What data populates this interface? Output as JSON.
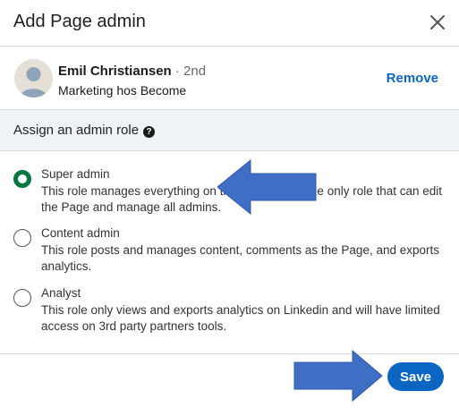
{
  "dialog": {
    "title": "Add Page admin"
  },
  "user": {
    "name": "Emil Christiansen",
    "degree": "· 2nd",
    "subtitle": "Marketing hos Become",
    "remove_label": "Remove"
  },
  "section": {
    "label": "Assign an admin role"
  },
  "roles": [
    {
      "title": "Super admin",
      "description": "This role manages everything on the Page and is the only role that can edit the Page and manage all admins.",
      "selected": true
    },
    {
      "title": "Content admin",
      "description": "This role posts and manages content, comments as the Page, and exports analytics.",
      "selected": false
    },
    {
      "title": "Analyst",
      "description": "This role only views and exports analytics on Linkedin and will have limited access on 3rd party partners tools.",
      "selected": false
    }
  ],
  "footer": {
    "save_label": "Save"
  },
  "colors": {
    "accent": "#0a66c2",
    "radio_selected": "#057642",
    "section_bg": "#eef3f8",
    "annotation_arrow": "#3e6fc4"
  },
  "icons": [
    "close-icon",
    "help-icon",
    "avatar",
    "annotation-arrow"
  ]
}
